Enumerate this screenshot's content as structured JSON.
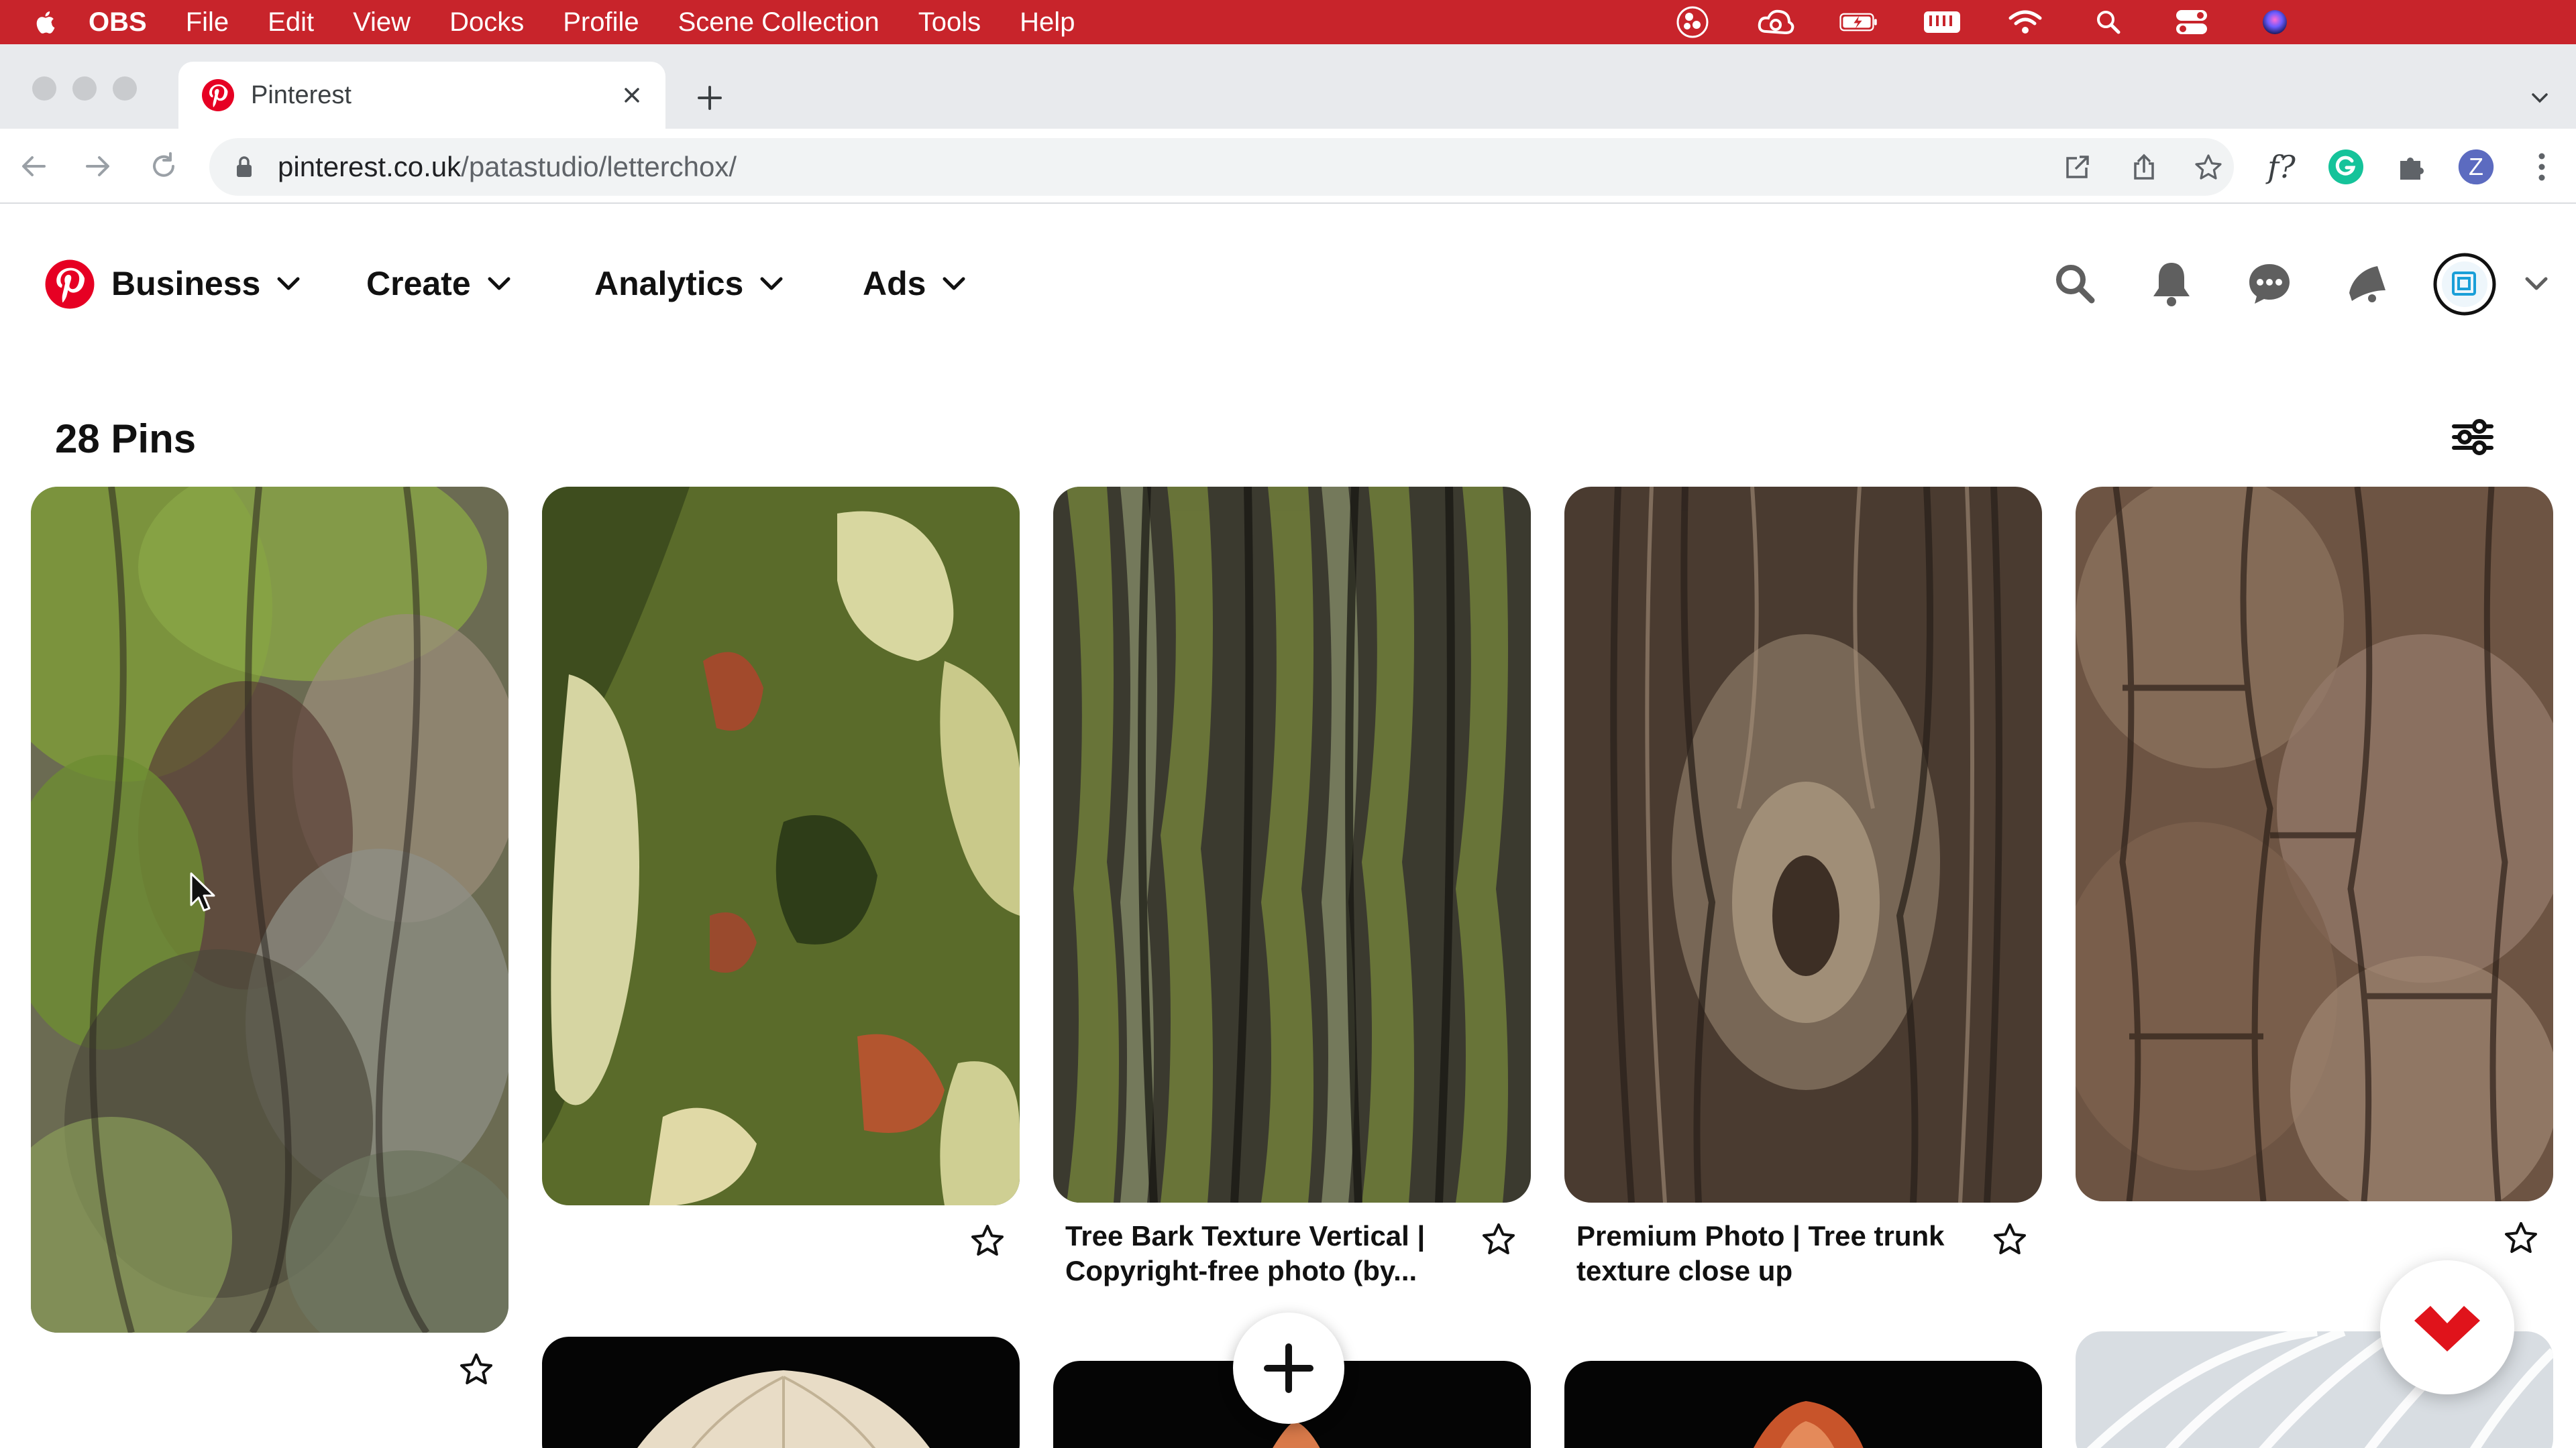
{
  "menubar": {
    "app_name": "OBS",
    "items": [
      "File",
      "Edit",
      "View",
      "Docks",
      "Profile",
      "Scene Collection",
      "Tools",
      "Help"
    ],
    "status_icons": [
      "obs-icon",
      "creative-cloud-icon",
      "battery-charging-icon",
      "keyboard-icon",
      "wifi-icon",
      "spotlight-search-icon",
      "control-center-icon",
      "siri-icon"
    ]
  },
  "browser": {
    "tab_title": "Pinterest",
    "url_host": "pinterest.co.uk",
    "url_path": "/patastudio/letterchox/",
    "profile_initial": "Z",
    "extension_label": "f?"
  },
  "pinterest": {
    "nav": {
      "business": "Business",
      "create": "Create",
      "analytics": "Analytics",
      "ads": "Ads"
    },
    "pins_count": "28 Pins",
    "pins": [
      {
        "title": "",
        "texture": "mossy-bark"
      },
      {
        "title": "",
        "texture": "plane-tree-camouflage"
      },
      {
        "title_line1": "Tree Bark Texture Vertical |",
        "title_line2": "Copyright-free photo (by...",
        "texture": "green-ridged-bark"
      },
      {
        "title_line1": "Premium Photo | Tree trunk",
        "title_line2": "texture close up",
        "texture": "brown-knotted-trunk"
      },
      {
        "title": "",
        "texture": "cracked-brown-bark"
      }
    ]
  },
  "colors": {
    "menubar": "#c8242b",
    "pinterest_red": "#e60023",
    "text": "#111111"
  }
}
